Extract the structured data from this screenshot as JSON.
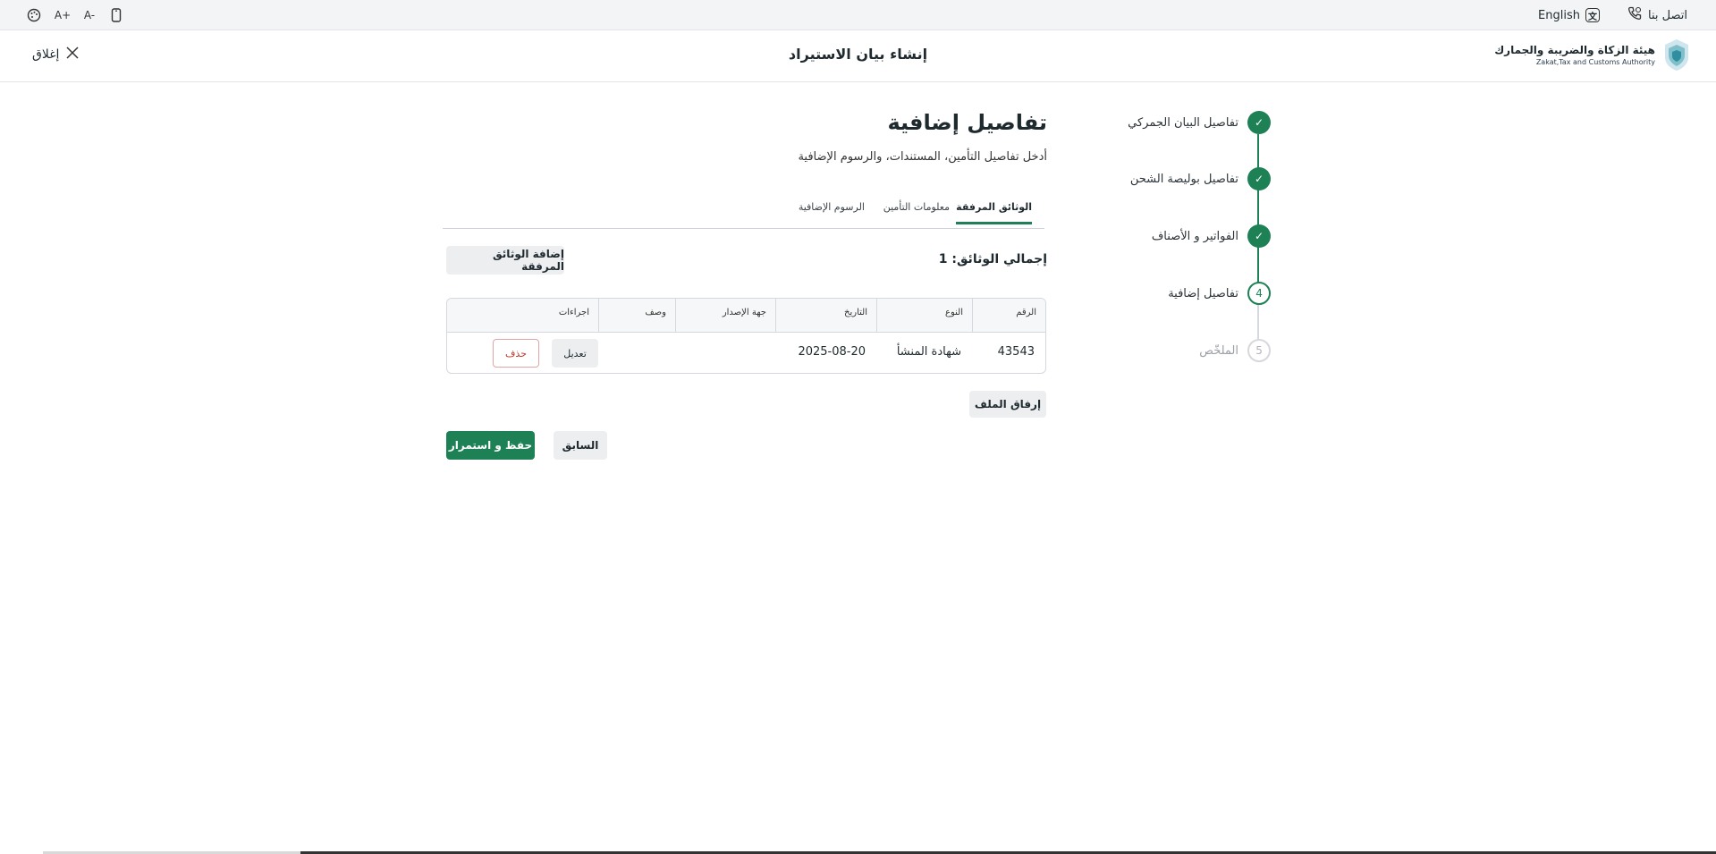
{
  "utility_bar": {
    "contact_label": "اتصل بنا",
    "language_label": "English",
    "icons": [
      "palette-icon",
      "font-increase-icon",
      "font-decrease-icon",
      "mobile-icon"
    ],
    "font_increase": "A+",
    "font_decrease": "A-"
  },
  "header": {
    "close_label": "إغلاق",
    "title": "إنشاء بيان الاستيراد",
    "logo_ar": "هيئة الزكاة والضريبة والجمارك",
    "logo_en": "Zakat,Tax and Customs Authority"
  },
  "stepper": {
    "steps": [
      {
        "label": "تفاصيل البيان الجمركي",
        "state": "done"
      },
      {
        "label": "تفاصيل بوليصة الشحن",
        "state": "done"
      },
      {
        "label": "الفواتير و الأصناف",
        "state": "done"
      },
      {
        "label": "تفاصيل إضافية",
        "state": "active",
        "number": "4"
      },
      {
        "label": "الملخّص",
        "state": "todo",
        "number": "5"
      }
    ]
  },
  "main": {
    "title": "تفاصيل إضافية",
    "subtitle": "أدخل تفاصيل التأمين، المستندات، والرسوم الإضافية",
    "tabs": [
      {
        "label": "الوثائق المرفقة",
        "active": true
      },
      {
        "label": "معلومات التأمين",
        "active": false
      },
      {
        "label": "الرسوم الإضافية",
        "active": false
      }
    ],
    "total_label": "إجمالي الوثائق: 1",
    "add_button": "إضافة الوثائق المرفقة",
    "table": {
      "headers": [
        "الرقم",
        "النوع",
        "التاريخ",
        "جهة الإصدار",
        "وصف",
        "اجراءات"
      ],
      "rows": [
        {
          "number": "43543",
          "type": "شهادة المنشأ",
          "date": "2025-08-20",
          "issuer": "",
          "description": "",
          "edit": "تعديل",
          "delete": "حذف"
        }
      ]
    },
    "attach_button": "إرفاق الملف",
    "previous_button": "السابق",
    "save_button": "حفظ و استمرار"
  },
  "colors": {
    "accent": "#1e8156",
    "danger": "#c0392b"
  }
}
